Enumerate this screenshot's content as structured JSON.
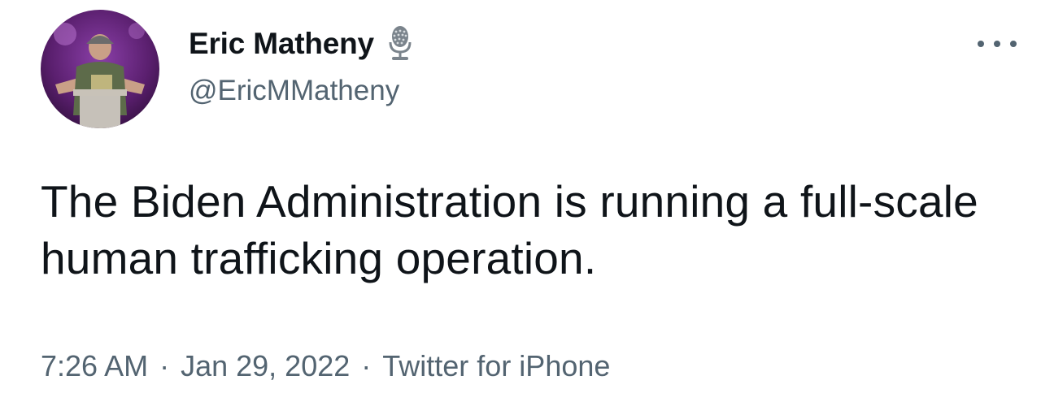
{
  "author": {
    "display_name": "Eric Matheny",
    "handle": "@EricMMatheny",
    "badge_icon": "microphone-icon",
    "avatar_icon": "profile-photo"
  },
  "tweet": {
    "text": "The Biden Administration is running a full-scale human trafficking operation."
  },
  "meta": {
    "time": "7:26 AM",
    "separator": "·",
    "date": "Jan 29, 2022",
    "source": "Twitter for iPhone"
  },
  "colors": {
    "text_primary": "#0f1419",
    "text_secondary": "#536471",
    "background": "#ffffff"
  }
}
